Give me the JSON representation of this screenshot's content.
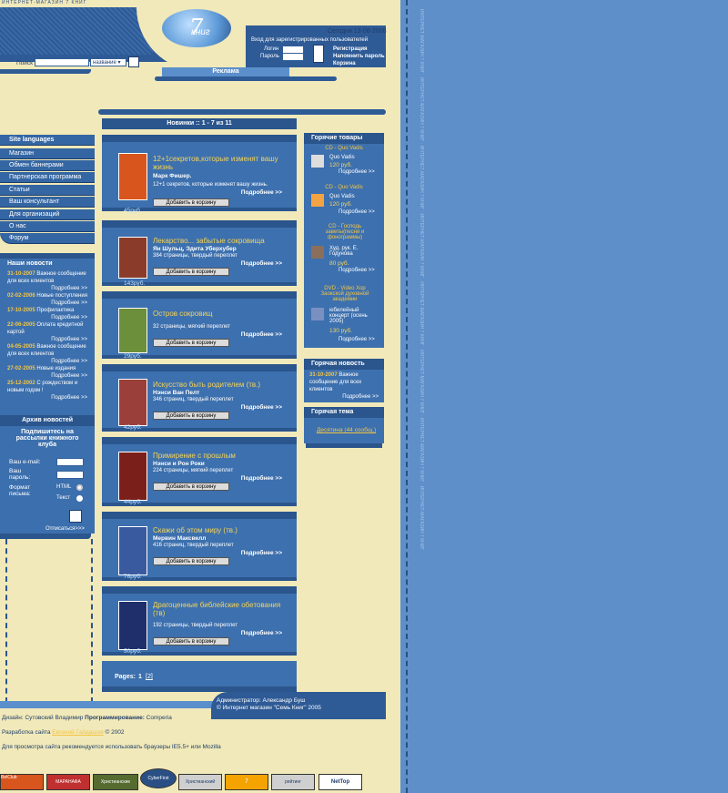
{
  "header": {
    "tagline": "ИНТЕРНЕТ-МАГАЗИН 7 КНИГ",
    "logo_number": "7",
    "logo_word": "книг",
    "date": "Сегодня 13-06-2008"
  },
  "login": {
    "title": "Вход для зарегистрированных пользователей",
    "login_label": "Логин",
    "password_label": "Пароль",
    "register": "Регистрация",
    "remind": "Напомнить пароль",
    "cart": "Корзина"
  },
  "search": {
    "label": "Поиск",
    "select_value": "название"
  },
  "ad": {
    "label": "Реклама"
  },
  "menu": [
    "Site languages",
    "Магазин",
    "Обмен баннерами",
    "Партнерская программа",
    "Статьи",
    "Ваш консультант",
    "Для организаций",
    "О нас",
    "Форум"
  ],
  "news": {
    "title": "Наши новости",
    "items": [
      {
        "date": "31-10-2007",
        "text": "Важное сообщение для всех клиентов"
      },
      {
        "date": "02-02-2006",
        "text": "Новые поступления"
      },
      {
        "date": "17-10-2005",
        "text": "Профилактика"
      },
      {
        "date": "22-06-2005",
        "text": "Оплата кредитной картой"
      },
      {
        "date": "04-05-2005",
        "text": "Важное сообщение для всех клиентов"
      },
      {
        "date": "27-02-2005",
        "text": "Новые издания"
      },
      {
        "date": "25-12-2002",
        "text": "С рождеством и новым годом !"
      }
    ],
    "more": "Подробнее >>",
    "archive": "Архив новостей"
  },
  "subscribe": {
    "title": "Подпишитесь на рассылки книжного клуба",
    "email_label": "Ваш e-mail:",
    "password_label": "Ваш пароль:",
    "format_label": "Формат письма:",
    "html": "HTML",
    "text": "Текст",
    "unsubscribe": "Отписаться>>>"
  },
  "main": {
    "title": "Новинки :: 1 - 7 из 11",
    "add_to_cart": "Добавить в корзину",
    "more": "Подробнее >>",
    "products": [
      {
        "title": "12+1секретов,которые изменят вашу жизнь",
        "author": "Марк Фишер.",
        "desc": "12+1 секретов, которые изменят вашу жизнь.",
        "price": "45руб.",
        "cover": "#d9551e"
      },
      {
        "title": "Лекарство... забытые сокровища",
        "author": "Ян Шульц, Эдита Уберхубер",
        "desc": "384 страницы, твердый переплет",
        "price": "143руб.",
        "cover": "#8a3b2a"
      },
      {
        "title": "Остров сокровищ",
        "author": "",
        "desc": "32 страницы, мягкий переплет",
        "price": "29руб.",
        "cover": "#6b8f3a"
      },
      {
        "title": "Искусство быть родителем (тв.)",
        "author": "Нэнси Ван Пелт",
        "desc": "346 страниц, твердый переплет",
        "price": "42руб.",
        "cover": "#9b3f3a"
      },
      {
        "title": "Примирение с прошлым",
        "author": "Нэнси и Рон Роки",
        "desc": "224 страницы, мягкий переплет",
        "price": "44руб.",
        "cover": "#7b1f1a"
      },
      {
        "title": "Скажи об этом миру (тв.)",
        "author": "Мервин Максвелл",
        "desc": "416 страниц, твердый переплет",
        "price": "76руб.",
        "cover": "#3a5aa0"
      },
      {
        "title": "Драгоценные библейские обетования (тв)",
        "author": "",
        "desc": "192 страницы, твердый переплет",
        "price": "50руб.",
        "cover": "#1f2f6b"
      }
    ],
    "pages_label": "Pages:",
    "page_current": "1",
    "page_next": "2"
  },
  "hot": {
    "title": "Горячие товары",
    "more": "Подробнее >>",
    "items": [
      {
        "name": "CD - Quo Vadis",
        "sub": "Quo Vadis",
        "price": "120 руб."
      },
      {
        "name": "CD - Quo Vadis",
        "sub": "Quo Vadis",
        "price": "120 руб."
      },
      {
        "name": "CD - Господь заветы(песни и фонограммы)",
        "sub": "Худ. рук. Е. Годунова",
        "price": "80 руб."
      },
      {
        "name": "DVD - Video Хор Заокской духовной академии",
        "sub": "юбилейный концерт (осень 2005)",
        "price": "130 руб."
      }
    ]
  },
  "hot_news": {
    "title": "Горячая новость",
    "date": "31-10-2007",
    "text": "Важное сообщение для всех клиентов",
    "more": "Подробнее >>"
  },
  "hot_topic": {
    "title": "Горячая тема",
    "link": "Десятина (44 сообщ.)"
  },
  "admin": {
    "line1_label": "Администратор:",
    "line1_name": "Александр Буш",
    "line2": "© Интернет магазин \"Семь Книг\" 2005"
  },
  "footer": {
    "design_label": "Дизайн:",
    "design_name": "Сутовский Владимир",
    "prog_label": "Программирование:",
    "prog_name": "Comperia",
    "dev_label": "Разработка сайта",
    "dev_name": "Евгений Гайдашов",
    "dev_year": "© 2002",
    "browser_note": "Для просмотра сайта рекомендуется использовать браузеры IE5.5+ или Mozilla"
  },
  "side_text": "ИНТЕРНЕТ-МАГАЗИН 7 КНИГ",
  "badges": [
    "BelClub",
    "МАРАНАФА",
    "Христианские",
    "CyberFirst",
    "Христианский",
    "7",
    "рейтинг",
    "NetTop"
  ]
}
